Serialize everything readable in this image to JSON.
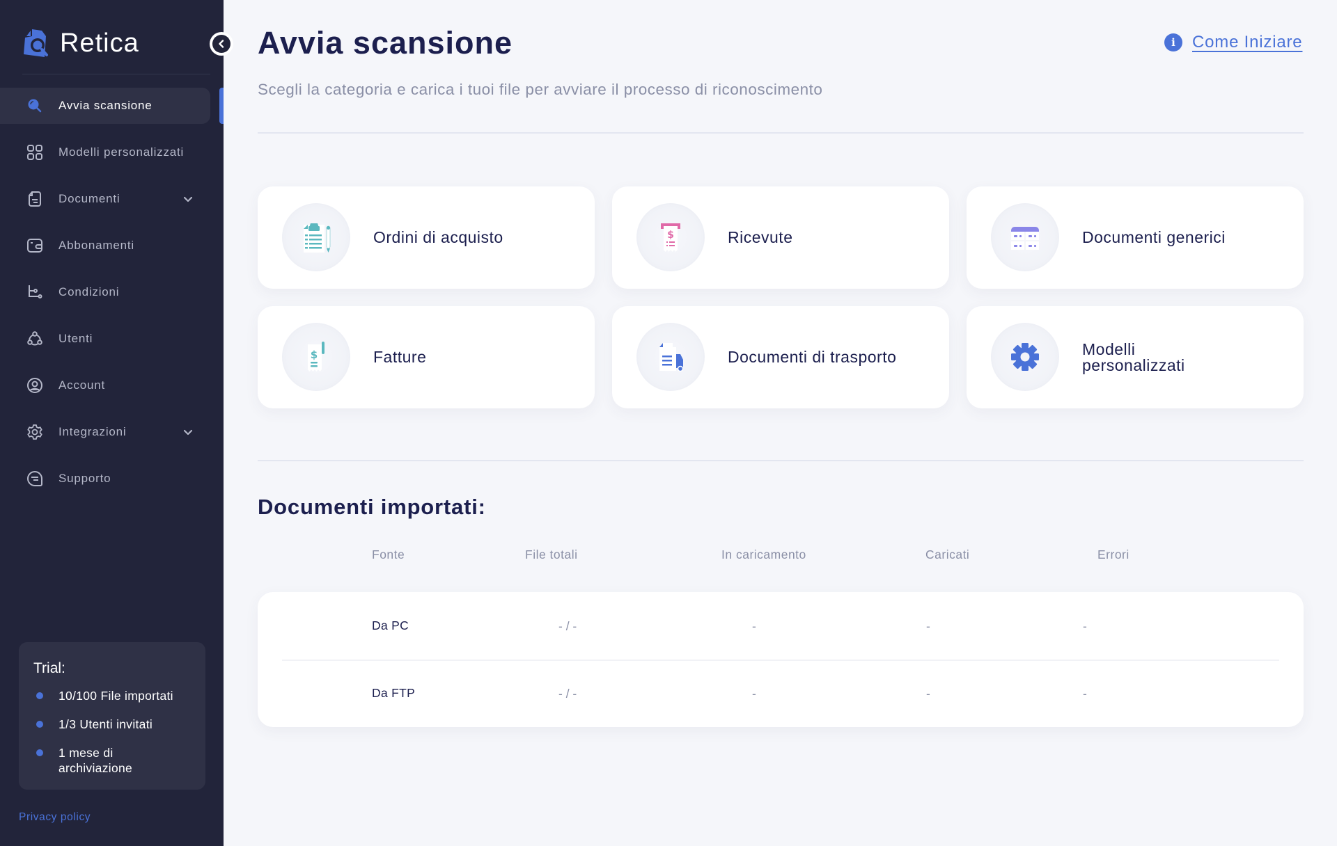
{
  "app": {
    "name": "Retica",
    "brand_color": "#4a72d8",
    "sidebar_bg": "#22243a"
  },
  "sidebar": {
    "collapse_icon": "chevron-left-icon",
    "items": [
      {
        "label": "Avvia scansione",
        "icon": "search-icon",
        "active": true,
        "has_submenu": false
      },
      {
        "label": "Modelli personalizzati",
        "icon": "grid-icon",
        "active": false,
        "has_submenu": false
      },
      {
        "label": "Documenti",
        "icon": "document-icon",
        "active": false,
        "has_submenu": true
      },
      {
        "label": "Abbonamenti",
        "icon": "wallet-icon",
        "active": false,
        "has_submenu": false
      },
      {
        "label": "Condizioni",
        "icon": "flow-icon",
        "active": false,
        "has_submenu": false
      },
      {
        "label": "Utenti",
        "icon": "users-icon",
        "active": false,
        "has_submenu": false
      },
      {
        "label": "Account",
        "icon": "account-icon",
        "active": false,
        "has_submenu": false
      },
      {
        "label": "Integrazioni",
        "icon": "gear-icon",
        "active": false,
        "has_submenu": true
      },
      {
        "label": "Supporto",
        "icon": "chat-icon",
        "active": false,
        "has_submenu": false
      }
    ],
    "trial": {
      "title": "Trial:",
      "items": [
        "10/100 File importati",
        "1/3 Utenti invitati",
        "1 mese di archiviazione"
      ]
    },
    "privacy_label": "Privacy policy"
  },
  "header": {
    "title": "Avvia scansione",
    "subtitle": "Scegli la categoria e carica i tuoi file per avviare il processo di riconoscimento",
    "help_label": "Come Iniziare",
    "help_icon": "info-icon"
  },
  "categories": [
    {
      "label": "Ordini di acquisto",
      "icon": "purchase-order-icon",
      "color": "#5bb8bf"
    },
    {
      "label": "Ricevute",
      "icon": "receipt-icon",
      "color": "#e06aa8"
    },
    {
      "label": "Documenti generici",
      "icon": "generic-document-icon",
      "color": "#8a86e8"
    },
    {
      "label": "Fatture",
      "icon": "invoice-icon",
      "color": "#5bb8bf"
    },
    {
      "label": "Documenti di trasporto",
      "icon": "transport-document-icon",
      "color": "#4a72d8"
    },
    {
      "label": "Modelli personalizzati",
      "icon": "gear-icon",
      "color": "#4a72d8"
    }
  ],
  "imports": {
    "title": "Documenti importati:",
    "columns": [
      "Fonte",
      "File totali",
      "In caricamento",
      "Caricati",
      "Errori"
    ],
    "rows": [
      {
        "source": "Da PC",
        "total": "- / -",
        "uploading": "-",
        "uploaded": "-",
        "errors": "-"
      },
      {
        "source": "Da FTP",
        "total": "- / -",
        "uploading": "-",
        "uploaded": "-",
        "errors": "-"
      }
    ]
  }
}
